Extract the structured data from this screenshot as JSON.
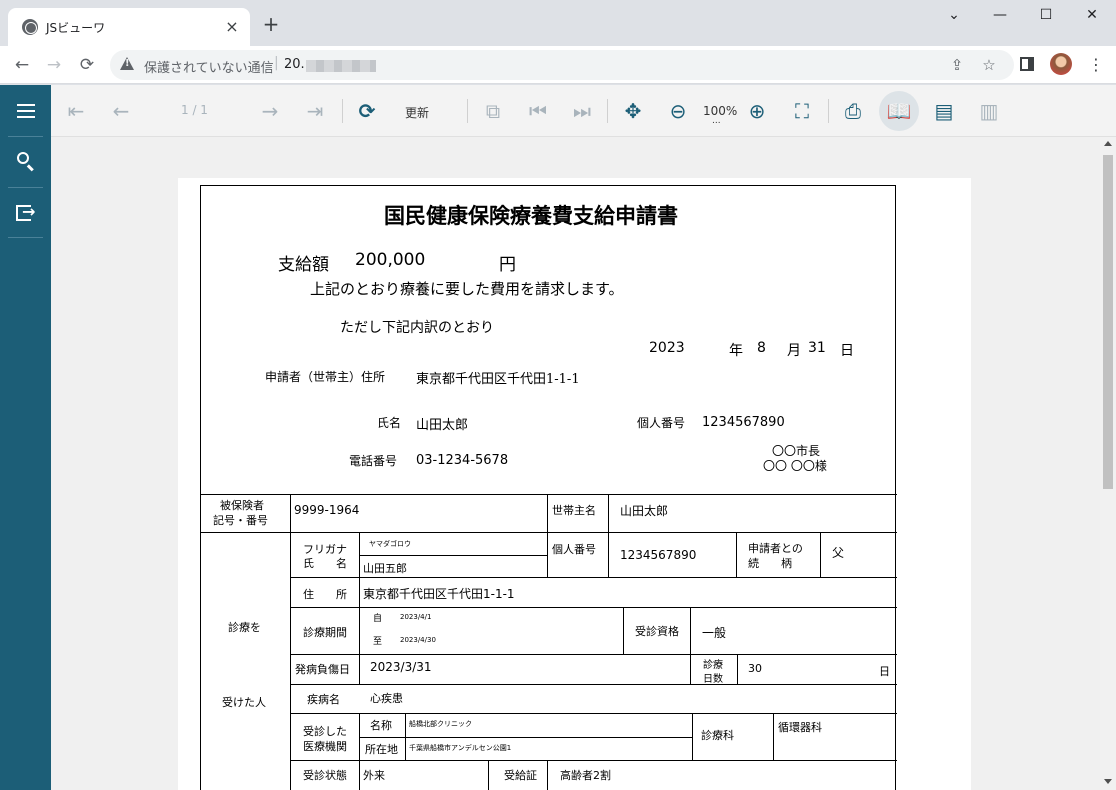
{
  "browser": {
    "tab_title": "JSビューワ",
    "tab_close": "×",
    "new_tab": "+",
    "window_controls": {
      "minimize": "—",
      "restore": "☐",
      "close": "✕",
      "chevron": "⌄"
    },
    "nav": {
      "back": "←",
      "forward": "→",
      "reload": "⟳"
    },
    "address": {
      "security_text": "保護されていない通信",
      "separator": "|",
      "url": "20."
    },
    "icons": [
      "share-icon",
      "star-icon",
      "side-panel-icon",
      "avatar",
      "kebab-menu-icon"
    ]
  },
  "viewer": {
    "sidebar": [
      "menu-icon",
      "search-icon",
      "export-icon"
    ],
    "toolbar": {
      "page_indicator": "1 / 1",
      "refresh_label": "更新",
      "zoom_label": "100%",
      "zoom_more": "...",
      "colors": {
        "enabled": "#1c5e77",
        "disabled": "#a9b4bc",
        "sidebar": "#1c5e77"
      }
    }
  },
  "document": {
    "title": "国民健康保険療養費支給申請書",
    "amount_label": "支給額",
    "amount_value": "200,000",
    "amount_unit": "円",
    "claim_text": "上記のとおり療養に要した費用を請求します。",
    "breakdown_text": "ただし下記内訳のとおり",
    "date": {
      "year": "2023",
      "year_unit": "年",
      "month": "8",
      "month_unit": "月",
      "day": "31",
      "day_unit": "日"
    },
    "applicant": {
      "address_label": "申請者（世帯主）住所",
      "address_value": "東京都千代田区千代田1-1-1",
      "name_label": "氏名",
      "name_value": "山田太郎",
      "mynumber_label": "個人番号",
      "mynumber_value": "1234567890",
      "phone_label": "電話番号",
      "phone_value": "03-1234-5678"
    },
    "addressee": {
      "line1": "〇〇市長",
      "line2": "〇〇 〇〇様"
    },
    "table": {
      "insured_label_1": "被保険者",
      "insured_label_2": "記号・番号",
      "insured_value": "9999-1964",
      "householder_label": "世帯主名",
      "householder_value": "山田太郎",
      "patient_label_1": "診療を",
      "patient_label_2": "受けた人",
      "furigana_label": "フリガナ",
      "name_label": "氏　　名",
      "furigana_value": "ヤマダゴロウ",
      "name_value": "山田五郎",
      "mynumber_label": "個人番号",
      "mynumber_value": "1234567890",
      "relation_label_1": "申請者との",
      "relation_label_2": "続　　柄",
      "relation_value": "父",
      "address_label": "住　　所",
      "address_value": "東京都千代田区千代田1-1-1",
      "period_label": "診療期間",
      "period_from_label": "自",
      "period_from_value": "2023/4/1",
      "period_to_label": "至",
      "period_to_value": "2023/4/30",
      "qualification_label": "受診資格",
      "qualification_value": "一般",
      "onset_label": "発病負傷日",
      "onset_value": "2023/3/31",
      "days_label_1": "診療",
      "days_label_2": "日数",
      "days_value": "30",
      "days_unit": "日",
      "disease_label": "疾病名",
      "disease_value": "心疾患",
      "facility_label_1": "受診した",
      "facility_label_2": "医療機関",
      "facility_name_label": "名称",
      "facility_name_value": "船橋北部クリニック",
      "facility_loc_label": "所在地",
      "facility_loc_value": "千葉県船橋市アンデルセン公園1",
      "department_label": "診療科",
      "department_value": "循環器科",
      "status_label": "受診状態",
      "status_value": "外来",
      "benefit_label": "受給証",
      "benefit_value": "高齢者2割"
    }
  }
}
